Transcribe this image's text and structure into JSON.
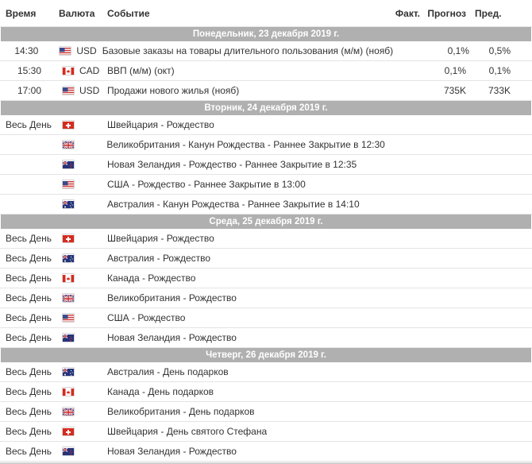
{
  "header": {
    "time": "Время",
    "currency": "Валюта",
    "event": "Событие",
    "actual": "Факт.",
    "forecast": "Прогноз",
    "previous": "Пред."
  },
  "days": [
    {
      "title": "Понедельник, 23 декабря 2019 г.",
      "rows": [
        {
          "time": "14:30",
          "flag": "us",
          "cur": "USD",
          "event": "Базовые заказы на товары длительного пользования (м/м) (нояб)",
          "actual": "",
          "forecast": "0,1%",
          "previous": "0,5%"
        },
        {
          "time": "15:30",
          "flag": "ca",
          "cur": "CAD",
          "event": "ВВП (м/м) (окт)",
          "actual": "",
          "forecast": "0,1%",
          "previous": "0,1%"
        },
        {
          "time": "17:00",
          "flag": "us",
          "cur": "USD",
          "event": "Продажи нового жилья (нояб)",
          "actual": "",
          "forecast": "735K",
          "previous": "733K"
        }
      ]
    },
    {
      "title": "Вторник, 24 декабря 2019 г.",
      "rows": [
        {
          "time": "Весь День",
          "flag": "ch",
          "cur": "",
          "event": "Швейцария - Рождество",
          "actual": "",
          "forecast": "",
          "previous": ""
        },
        {
          "time": "",
          "flag": "gb",
          "cur": "",
          "event": "Великобритания - Канун Рождества - Раннее Закрытие в 12:30",
          "actual": "",
          "forecast": "",
          "previous": ""
        },
        {
          "time": "",
          "flag": "nz",
          "cur": "",
          "event": "Новая Зеландия - Рождество - Раннее Закрытие в 12:35",
          "actual": "",
          "forecast": "",
          "previous": ""
        },
        {
          "time": "",
          "flag": "us",
          "cur": "",
          "event": "США - Рождество - Раннее Закрытие в 13:00",
          "actual": "",
          "forecast": "",
          "previous": ""
        },
        {
          "time": "",
          "flag": "au",
          "cur": "",
          "event": "Австралия - Канун Рождества - Раннее Закрытие в 14:10",
          "actual": "",
          "forecast": "",
          "previous": ""
        }
      ]
    },
    {
      "title": "Среда, 25 декабря 2019 г.",
      "rows": [
        {
          "time": "Весь День",
          "flag": "ch",
          "cur": "",
          "event": "Швейцария - Рождество",
          "actual": "",
          "forecast": "",
          "previous": ""
        },
        {
          "time": "Весь День",
          "flag": "au",
          "cur": "",
          "event": "Австралия - Рождество",
          "actual": "",
          "forecast": "",
          "previous": ""
        },
        {
          "time": "Весь День",
          "flag": "ca",
          "cur": "",
          "event": "Канада - Рождество",
          "actual": "",
          "forecast": "",
          "previous": ""
        },
        {
          "time": "Весь День",
          "flag": "gb",
          "cur": "",
          "event": "Великобритания - Рождество",
          "actual": "",
          "forecast": "",
          "previous": ""
        },
        {
          "time": "Весь День",
          "flag": "us",
          "cur": "",
          "event": "США - Рождество",
          "actual": "",
          "forecast": "",
          "previous": ""
        },
        {
          "time": "Весь День",
          "flag": "nz",
          "cur": "",
          "event": "Новая Зеландия - Рождество",
          "actual": "",
          "forecast": "",
          "previous": ""
        }
      ]
    },
    {
      "title": "Четверг, 26 декабря 2019 г.",
      "rows": [
        {
          "time": "Весь День",
          "flag": "au",
          "cur": "",
          "event": "Австралия - День подарков",
          "actual": "",
          "forecast": "",
          "previous": ""
        },
        {
          "time": "Весь День",
          "flag": "ca",
          "cur": "",
          "event": "Канада - День подарков",
          "actual": "",
          "forecast": "",
          "previous": ""
        },
        {
          "time": "Весь День",
          "flag": "gb",
          "cur": "",
          "event": "Великобритания - День подарков",
          "actual": "",
          "forecast": "",
          "previous": ""
        },
        {
          "time": "Весь День",
          "flag": "ch",
          "cur": "",
          "event": "Швейцария - День святого Стефана",
          "actual": "",
          "forecast": "",
          "previous": ""
        },
        {
          "time": "Весь День",
          "flag": "nz",
          "cur": "",
          "event": "Новая Зеландия - Рождество",
          "actual": "",
          "forecast": "",
          "previous": ""
        }
      ]
    }
  ]
}
